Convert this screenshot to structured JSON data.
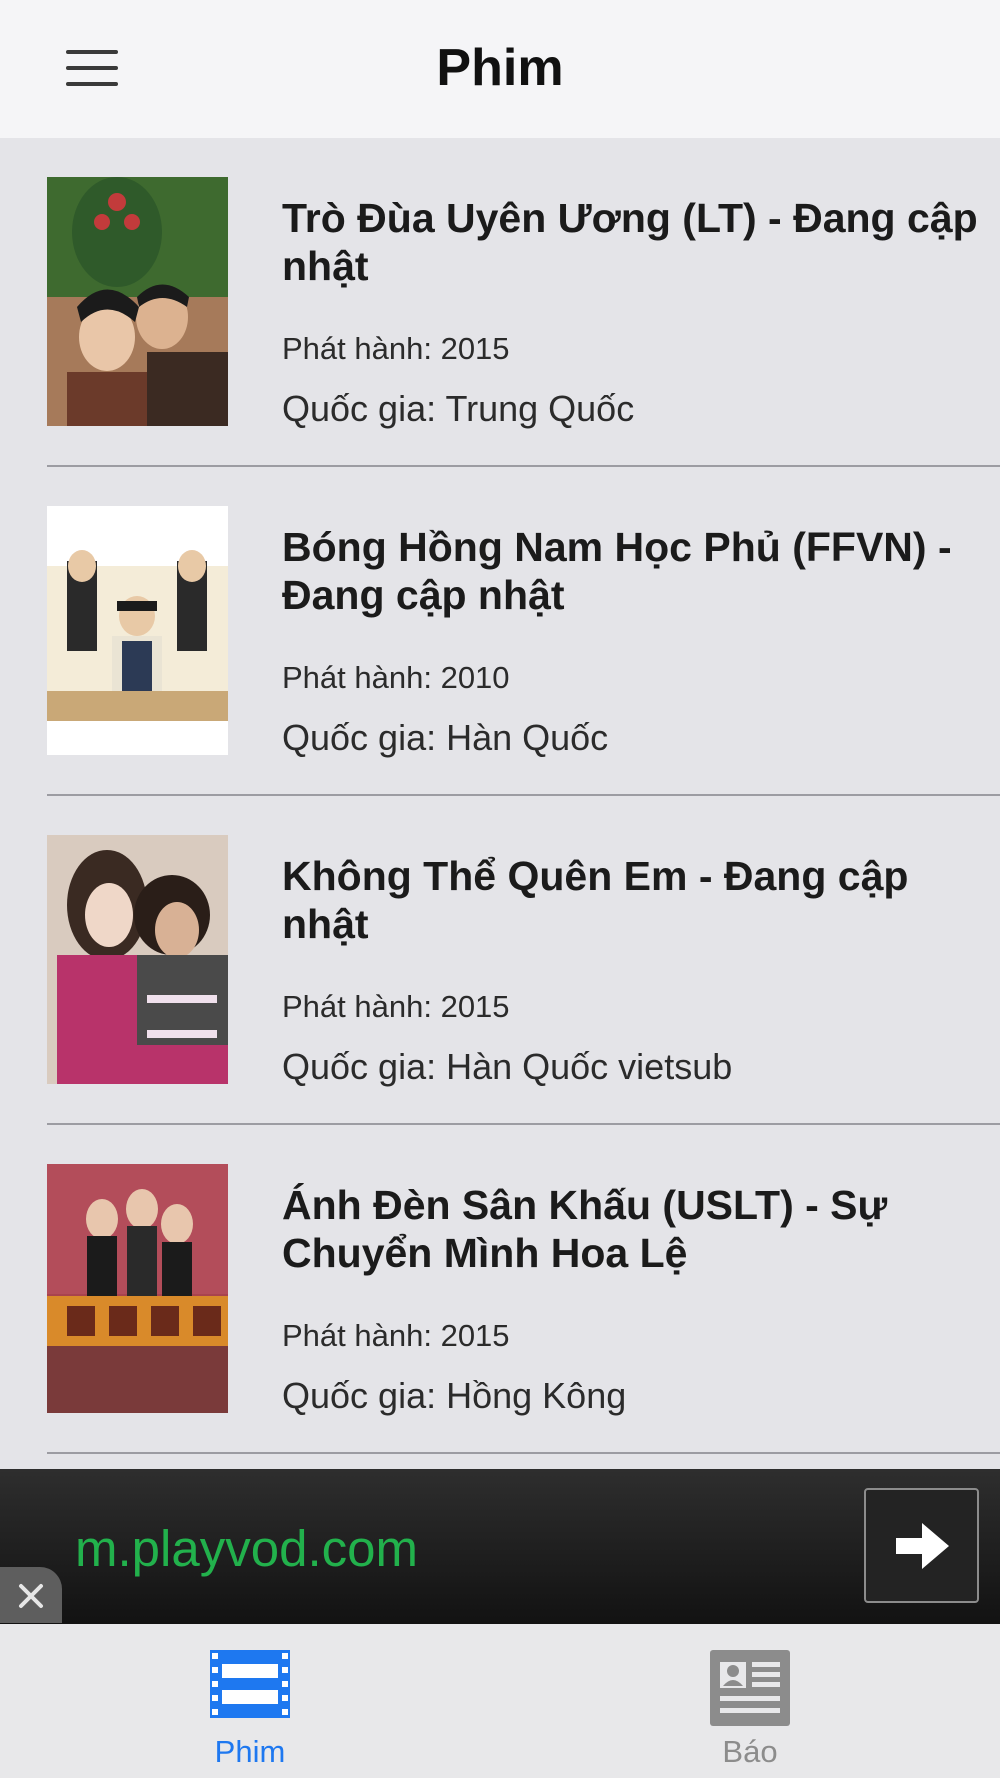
{
  "header": {
    "title": "Phim",
    "menu_icon": "hamburger-menu-icon"
  },
  "movies": [
    {
      "title": "Trò Đùa Uyên Ương (LT) - Đang cập nhật",
      "year": "Phát hành: 2015",
      "country": "Quốc gia: Trung Quốc"
    },
    {
      "title": "Bóng Hồng Nam Học Phủ (FFVN) - Đang cập nhật",
      "year": "Phát hành: 2010",
      "country": "Quốc gia: Hàn Quốc"
    },
    {
      "title": "Không Thể Quên Em - Đang cập nhật",
      "year": "Phát hành: 2015",
      "country": "Quốc gia: Hàn Quốc vietsub"
    },
    {
      "title": "Ánh Đèn Sân Khấu (USLT) - Sự Chuyển Mình Hoa Lệ",
      "year": "Phát hành: 2015",
      "country": "Quốc gia: Hồng Kông"
    }
  ],
  "ad": {
    "text": "m.playvod.com",
    "text_color": "#22b14c"
  },
  "tabbar": {
    "items": [
      {
        "label": "Phim",
        "icon": "film-icon",
        "active": true,
        "color": "#1e78f0"
      },
      {
        "label": "Báo",
        "icon": "newspaper-icon",
        "active": false,
        "color": "#8c8c8c"
      }
    ]
  }
}
